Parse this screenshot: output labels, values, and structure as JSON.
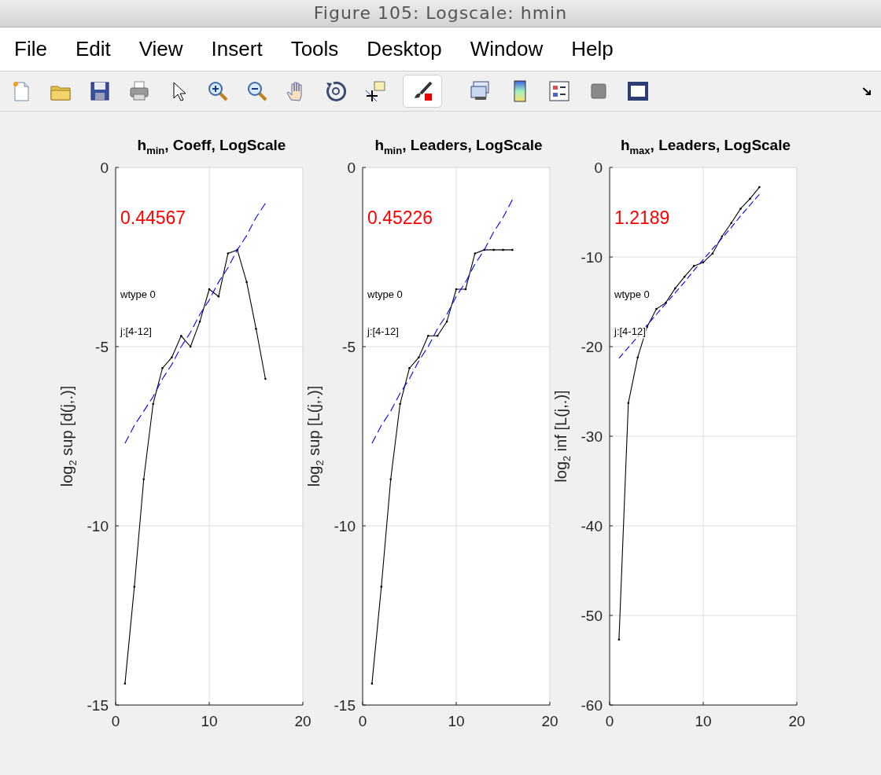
{
  "window": {
    "title": "Figure 105: Logscale: hmin"
  },
  "menu": [
    "File",
    "Edit",
    "View",
    "Insert",
    "Tools",
    "Desktop",
    "Window",
    "Help"
  ],
  "axes": [
    {
      "chart_data": {
        "type": "line",
        "title": "h$_{min}$, Coeff, LogScale",
        "ylabel": "log$_{2}$ sup [d(j,.)]",
        "x": [
          1,
          2,
          3,
          4,
          5,
          6,
          7,
          8,
          9,
          10,
          11,
          12,
          13,
          14,
          15,
          16
        ],
        "xlim": [
          0,
          20
        ],
        "ylim": [
          -15,
          0
        ],
        "xticks": [
          0,
          10,
          20
        ],
        "yticks": [
          0,
          -5,
          -10,
          -15
        ],
        "grid": true,
        "series": [
          {
            "color": "#000000",
            "line_style": "solid",
            "values": [
              -14.4,
              -11.7,
              -8.7,
              -6.6,
              -5.6,
              -5.3,
              -4.7,
              -5.0,
              -4.3,
              -3.4,
              -3.6,
              -2.4,
              -2.3,
              -3.2,
              -4.5,
              -5.9
            ]
          },
          {
            "color": "#0000ff",
            "line_style": "dashed",
            "values": [
              -7.7,
              -7.2,
              -6.8,
              -6.4,
              -5.9,
              -5.5,
              -5.0,
              -4.6,
              -4.1,
              -3.7,
              -3.2,
              -2.8,
              -2.3,
              -1.9,
              -1.4,
              -1.0
            ]
          }
        ],
        "annotations": [
          "0.44567",
          "wtype 0",
          "j:[4-12]"
        ]
      }
    },
    {
      "chart_data": {
        "type": "line",
        "title": "h$_{min}$, Leaders, LogScale",
        "ylabel": "log$_{2}$ sup [L(j,.)]",
        "x": [
          1,
          2,
          3,
          4,
          5,
          6,
          7,
          8,
          9,
          10,
          11,
          12,
          13,
          14,
          15,
          16
        ],
        "xlim": [
          0,
          20
        ],
        "ylim": [
          -15,
          0
        ],
        "xticks": [
          0,
          10,
          20
        ],
        "yticks": [
          0,
          -5,
          -10,
          -15
        ],
        "grid": true,
        "series": [
          {
            "color": "#000000",
            "line_style": "solid",
            "values": [
              -14.4,
              -11.7,
              -8.7,
              -6.6,
              -5.6,
              -5.3,
              -4.7,
              -4.7,
              -4.3,
              -3.4,
              -3.4,
              -2.4,
              -2.3,
              -2.3,
              -2.3,
              -2.3
            ]
          },
          {
            "color": "#0000ff",
            "line_style": "dashed",
            "values": [
              -7.7,
              -7.2,
              -6.8,
              -6.3,
              -5.9,
              -5.4,
              -5.0,
              -4.5,
              -4.1,
              -3.6,
              -3.2,
              -2.7,
              -2.3,
              -1.8,
              -1.4,
              -0.9
            ]
          }
        ],
        "annotations": [
          "0.45226",
          "wtype 0",
          "j:[4-12]"
        ]
      }
    },
    {
      "chart_data": {
        "type": "line",
        "title": "h$_{max}$, Leaders, LogScale",
        "ylabel": "log$_{2}$ inf [L(j,.)]",
        "x": [
          1,
          2,
          3,
          4,
          5,
          6,
          7,
          8,
          9,
          10,
          11,
          12,
          13,
          14,
          15,
          16
        ],
        "xlim": [
          0,
          20
        ],
        "ylim": [
          -60,
          0
        ],
        "xticks": [
          0,
          10,
          20
        ],
        "yticks": [
          0,
          -10,
          -20,
          -30,
          -40,
          -50,
          -60
        ],
        "grid": true,
        "series": [
          {
            "color": "#000000",
            "line_style": "solid",
            "values": [
              -52.7,
              -26.3,
              -21.2,
              -17.8,
              -15.8,
              -15.1,
              -13.5,
              -12.2,
              -11.0,
              -10.6,
              -9.6,
              -7.7,
              -6.2,
              -4.6,
              -3.5,
              -2.2
            ]
          },
          {
            "color": "#0000ff",
            "line_style": "dashed",
            "values": [
              -21.3,
              -20.1,
              -18.9,
              -17.6,
              -16.4,
              -15.2,
              -14.0,
              -12.8,
              -11.5,
              -10.3,
              -9.1,
              -7.9,
              -6.7,
              -5.4,
              -4.2,
              -3.0
            ]
          }
        ],
        "annotations": [
          "1.2189",
          "wtype 0",
          "j:[4-12]"
        ]
      }
    }
  ]
}
